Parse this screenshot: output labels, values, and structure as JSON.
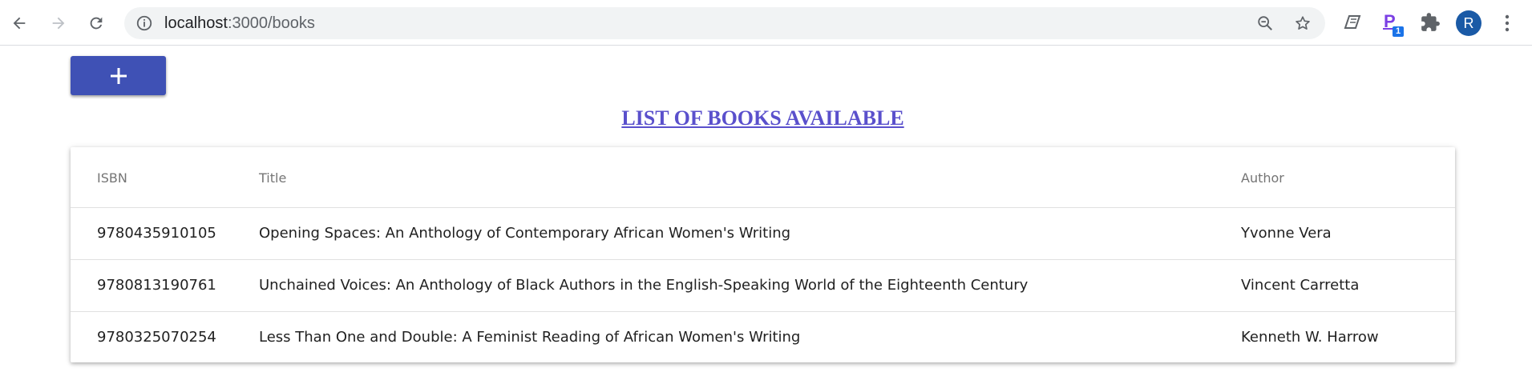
{
  "browser": {
    "url_host": "localhost",
    "url_path": ":3000/books",
    "extension_badge": "1",
    "profile_initial": "R",
    "icons": {
      "back": "back-arrow-icon",
      "forward": "forward-arrow-icon",
      "reload": "reload-icon",
      "site_info": "info-icon",
      "zoom": "zoom-out-icon",
      "bookmark": "star-icon",
      "ext1": "reader-mode-icon",
      "ext2": "p-extension-icon",
      "extensions": "puzzle-icon",
      "menu": "kebab-menu-icon"
    }
  },
  "page": {
    "add_button_icon": "plus-icon",
    "heading": "LIST OF BOOKS AVAILABLE",
    "accent_color": "#3f51b5",
    "heading_color": "#5a50cc"
  },
  "table": {
    "columns": [
      "ISBN",
      "Title",
      "Author"
    ],
    "rows": [
      {
        "isbn": "9780435910105",
        "title": "Opening Spaces: An Anthology of Contemporary African Women's Writing",
        "author": "Yvonne Vera"
      },
      {
        "isbn": "9780813190761",
        "title": "Unchained Voices: An Anthology of Black Authors in the English-Speaking World of the Eighteenth Century",
        "author": "Vincent Carretta"
      },
      {
        "isbn": "9780325070254",
        "title": "Less Than One and Double: A Feminist Reading of African Women's Writing",
        "author": "Kenneth W. Harrow"
      }
    ]
  }
}
